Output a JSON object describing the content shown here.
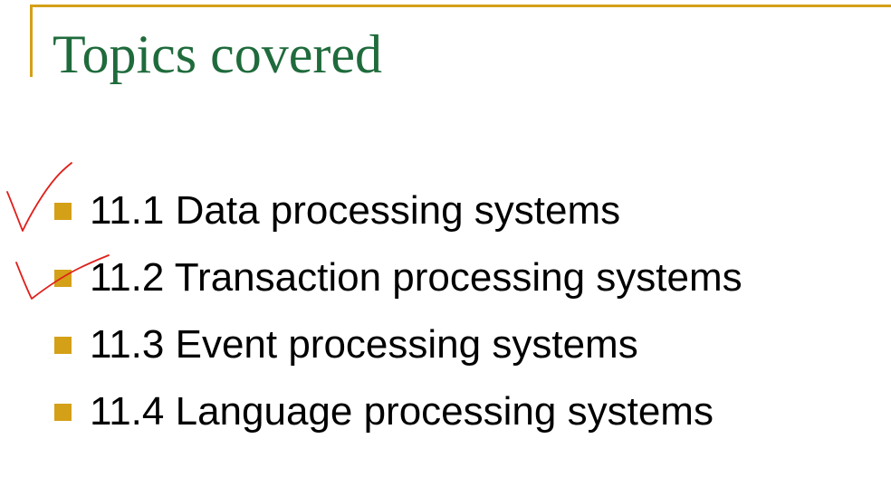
{
  "slide": {
    "title": "Topics covered",
    "items": [
      {
        "label": "11.1 Data processing systems"
      },
      {
        "label": "11.2 Transaction processing systems"
      },
      {
        "label": "11.3 Event processing systems"
      },
      {
        "label": "11.4 Language processing systems"
      }
    ]
  },
  "colors": {
    "title": "#1f6b3c",
    "accent": "#d4a017",
    "body_text": "#000000",
    "handwritten_mark": "#e0201b"
  },
  "annotations": {
    "checkmarks_on_items": [
      1,
      2
    ],
    "checkmark_icon": "handwritten-checkmark-icon"
  }
}
